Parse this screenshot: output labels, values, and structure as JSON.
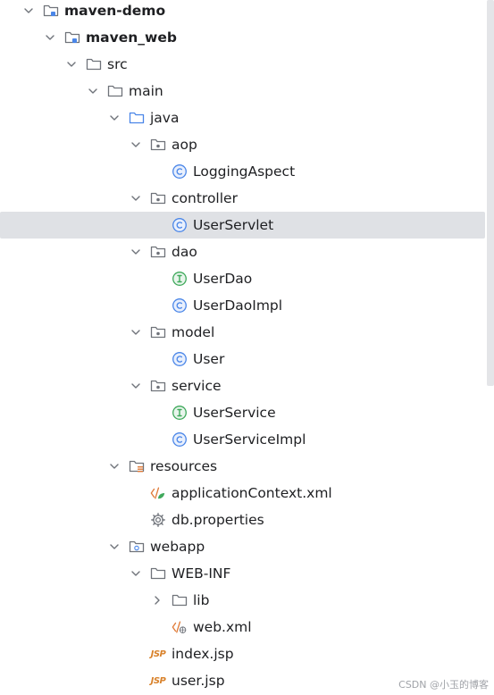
{
  "tree": {
    "nodes": [
      {
        "label": "maven-demo",
        "icon": "module-folder-icon",
        "bold": true,
        "expanded": true
      },
      {
        "label": "maven_web",
        "icon": "module-folder-icon",
        "bold": true,
        "expanded": true
      },
      {
        "label": "src",
        "icon": "folder-icon",
        "expanded": true
      },
      {
        "label": "main",
        "icon": "folder-icon",
        "expanded": true
      },
      {
        "label": "java",
        "icon": "source-folder-icon",
        "expanded": true
      },
      {
        "label": "aop",
        "icon": "package-icon",
        "expanded": true
      },
      {
        "label": "LoggingAspect",
        "icon": "class-icon"
      },
      {
        "label": "controller",
        "icon": "package-icon",
        "expanded": true
      },
      {
        "label": "UserServlet",
        "icon": "class-icon",
        "selected": true
      },
      {
        "label": "dao",
        "icon": "package-icon",
        "expanded": true
      },
      {
        "label": "UserDao",
        "icon": "interface-icon"
      },
      {
        "label": "UserDaoImpl",
        "icon": "class-icon"
      },
      {
        "label": "model",
        "icon": "package-icon",
        "expanded": true
      },
      {
        "label": "User",
        "icon": "class-icon"
      },
      {
        "label": "service",
        "icon": "package-icon",
        "expanded": true
      },
      {
        "label": "UserService",
        "icon": "interface-icon"
      },
      {
        "label": "UserServiceImpl",
        "icon": "class-icon"
      },
      {
        "label": "resources",
        "icon": "resources-folder-icon",
        "expanded": true
      },
      {
        "label": "applicationContext.xml",
        "icon": "spring-xml-icon"
      },
      {
        "label": "db.properties",
        "icon": "properties-gear-icon"
      },
      {
        "label": "webapp",
        "icon": "web-folder-icon",
        "expanded": true
      },
      {
        "label": "WEB-INF",
        "icon": "folder-icon",
        "expanded": true
      },
      {
        "label": "lib",
        "icon": "folder-icon",
        "expanded": false
      },
      {
        "label": "web.xml",
        "icon": "web-xml-icon"
      },
      {
        "label": "index.jsp",
        "icon": "jsp-icon",
        "icon_text": "JSP"
      },
      {
        "label": "user.jsp",
        "icon": "jsp-icon",
        "icon_text": "JSP"
      }
    ]
  },
  "watermark": "CSDN @小玉的博客",
  "colors": {
    "selection": "#dfe1e5",
    "class_icon": "#4a86e8",
    "interface_icon": "#3fa95b",
    "folder_icon": "#6f737a",
    "jsp_icon": "#d9822b",
    "xml_icon": "#e07b39"
  }
}
